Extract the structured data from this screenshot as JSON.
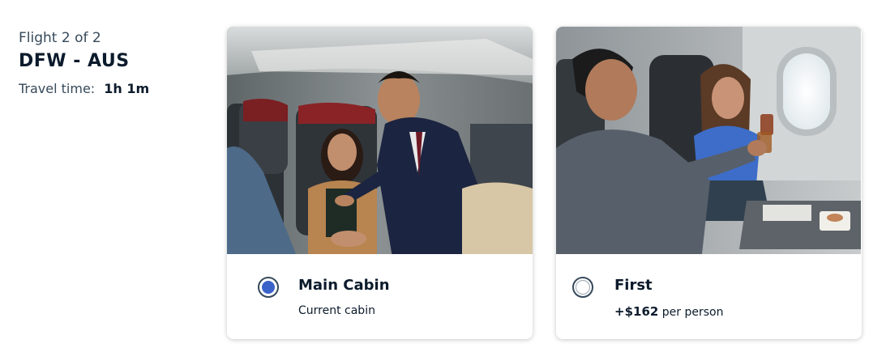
{
  "flight": {
    "count_label": "Flight 2 of 2",
    "route": "DFW - AUS",
    "travel_time_label": "Travel time:",
    "travel_time_value": "1h 1m"
  },
  "cabins": [
    {
      "name": "Main Cabin",
      "subtitle": "Current cabin",
      "selected": true,
      "photo_desc": "main-cabin-photo"
    },
    {
      "name": "First",
      "price": "+$162",
      "price_suffix": "per person",
      "selected": false,
      "photo_desc": "first-cabin-photo"
    }
  ],
  "colors": {
    "accent_radio": "#3a62c9",
    "text_dark": "#0c1b2c",
    "text_muted": "#36495a"
  }
}
